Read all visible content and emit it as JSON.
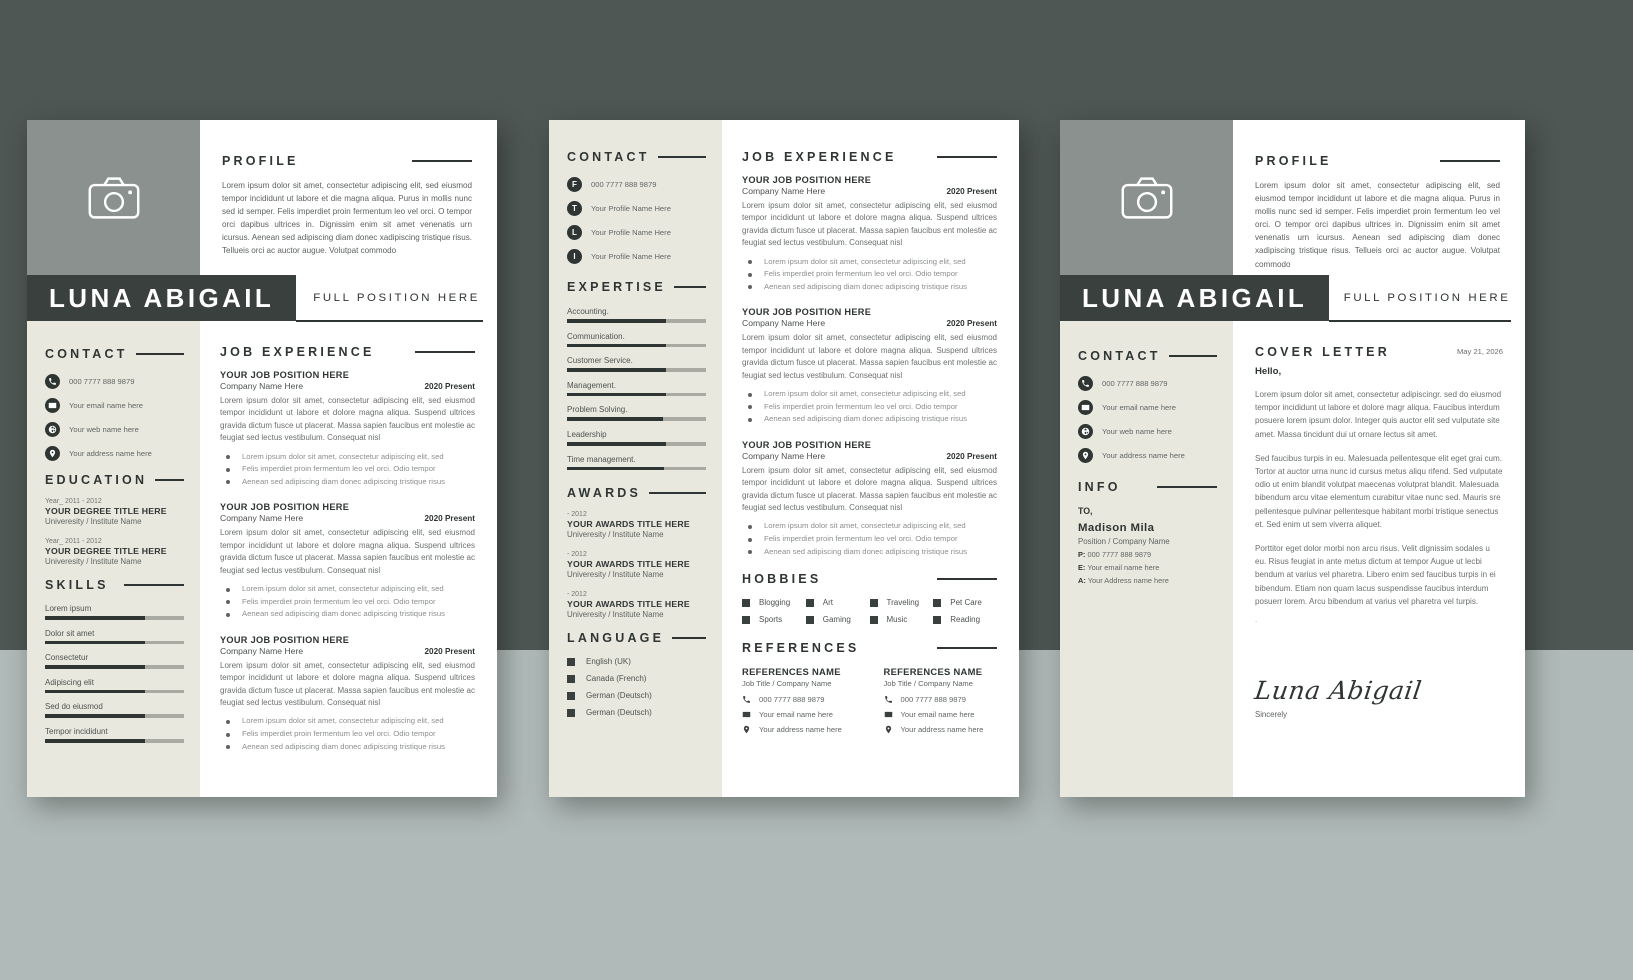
{
  "theme": {
    "bg_top": "#4e5754",
    "bg_bottom": "#b0bab8",
    "dark": "#3a403d",
    "sidebar": "#e9e8df",
    "photo_grey": "#8a918e",
    "bar_track": "#a9aaa2"
  },
  "person": {
    "name": "LUNA ABIGAIL",
    "position": "FULL POSITION HERE"
  },
  "sections": {
    "profile": "PROFILE",
    "contact": "CONTACT",
    "education": "EDUCATION",
    "skills": "SKILLS",
    "job_experience": "JOB EXPERIENCE",
    "expertise": "EXPERTISE",
    "awards": "AWARDS",
    "language": "LANGUAGE",
    "hobbies": "HOBBIES",
    "references": "REFERENCES",
    "cover_letter": "COVER LETTER",
    "info": "INFO"
  },
  "profile_text": "Lorem ipsum dolor sit amet, consectetur adipiscing elit, sed eiusmod tempor incididunt ut labore et die magna aliqua. Purus in mollis nunc sed id semper. Felis imperdiet proin fermentum leo vel orci. O tempor orci dapibus ultrices in. Dignissim enim sit amet venenatis urn icursus. Aenean sed adipiscing diam donec xadipiscing tristique risus. Tellueis orci ac auctor augue. Volutpat commodo",
  "contact_items": [
    {
      "icon": "phone-icon",
      "text": "000 7777 888 9879"
    },
    {
      "icon": "email-icon",
      "text": "Your email name here"
    },
    {
      "icon": "web-icon",
      "text": "Your web name here"
    },
    {
      "icon": "location-icon",
      "text": "Your address name here"
    }
  ],
  "social_items": [
    {
      "icon": "facebook-icon",
      "letter": "F",
      "text": "000 7777 888 9879"
    },
    {
      "icon": "twitter-icon",
      "letter": "T",
      "text": "Your Profile Name Here"
    },
    {
      "icon": "linkedin-icon",
      "letter": "L",
      "text": "Your Profile Name Here"
    },
    {
      "icon": "instagram-icon",
      "letter": "I",
      "text": "Your Profile Name Here"
    }
  ],
  "education": [
    {
      "year": "Year_ 2011 - 2012",
      "title": "YOUR DEGREE TITLE HERE",
      "school": "Univeresity / Institute Name"
    },
    {
      "year": "Year_ 2011 - 2012",
      "title": "YOUR DEGREE TITLE HERE",
      "school": "Univeresity / Institute Name"
    }
  ],
  "skills": [
    {
      "name": "Lorem ipsum",
      "value": 72
    },
    {
      "name": "Dolor sit amet",
      "value": 72
    },
    {
      "name": "Consectetur",
      "value": 72
    },
    {
      "name": "Adipiscing elit",
      "value": 72
    },
    {
      "name": "Sed do eiusmod",
      "value": 72
    },
    {
      "name": "Tempor incididunt",
      "value": 72
    }
  ],
  "expertise": [
    {
      "name": "Accounting.",
      "value": 71
    },
    {
      "name": "Communication.",
      "value": 71
    },
    {
      "name": "Customer Service.",
      "value": 71
    },
    {
      "name": "Management.",
      "value": 71
    },
    {
      "name": "Problem Solving.",
      "value": 69
    },
    {
      "name": "Leadership",
      "value": 71
    },
    {
      "name": "Time management.",
      "value": 70
    }
  ],
  "jobs": [
    {
      "position": "YOUR JOB POSITION HERE",
      "company": "Company Name Here",
      "date": "2020 Present",
      "desc": "Lorem ipsum dolor sit amet, consectetur adipiscing elit, sed eiusmod tempor incididunt ut labore et dolore magna aliqua. Suspend ultrices gravida dictum fusce ut placerat. Massa sapien faucibus ent molestie ac feugiat sed lectus vestibulum. Consequat nisl",
      "bullets": [
        "Lorem ipsum dolor sit amet, consectetur adipiscing elit, sed",
        "Felis imperdiet proin fermentum leo vel orci. Odio tempor",
        "Aenean sed adipiscing diam donec adipiscing tristique risus"
      ]
    },
    {
      "position": "YOUR JOB POSITION HERE",
      "company": "Company Name Here",
      "date": "2020 Present",
      "desc": "Lorem ipsum dolor sit amet, consectetur adipiscing elit, sed eiusmod tempor incididunt ut labore et dolore magna aliqua. Suspend ultrices gravida dictum fusce ut placerat. Massa sapien faucibus ent molestie ac feugiat sed lectus vestibulum. Consequat nisl",
      "bullets": [
        "Lorem ipsum dolor sit amet, consectetur adipiscing elit, sed",
        "Felis imperdiet proin fermentum leo vel orci. Odio tempor",
        "Aenean sed adipiscing diam donec adipiscing tristique risus"
      ]
    },
    {
      "position": "YOUR JOB POSITION HERE",
      "company": "Company Name Here",
      "date": "2020 Present",
      "desc": "Lorem ipsum dolor sit amet, consectetur adipiscing elit, sed eiusmod tempor incididunt ut labore et dolore magna aliqua. Suspend ultrices gravida dictum fusce ut placerat. Massa sapien faucibus ent molestie ac feugiat sed lectus vestibulum. Consequat nisl",
      "bullets": [
        "Lorem ipsum dolor sit amet, consectetur adipiscing elit, sed",
        "Felis imperdiet proin fermentum leo vel orci. Odio tempor",
        "Aenean sed adipiscing diam donec adipiscing tristique risus"
      ]
    }
  ],
  "awards": [
    {
      "year": "- 2012",
      "title": "YOUR AWARDS TITLE HERE",
      "school": "Univeresity / Institute Name"
    },
    {
      "year": "- 2012",
      "title": "YOUR AWARDS TITLE HERE",
      "school": "Univeresity / Institute Name"
    },
    {
      "year": "- 2012",
      "title": "YOUR AWARDS TITLE HERE",
      "school": "Univeresity / Institute Name"
    }
  ],
  "languages": [
    "English (UK)",
    "Canada (French)",
    "German (Deutsch)",
    "German (Deutsch)"
  ],
  "hobbies": [
    "Blogging",
    "Art",
    "Traveling",
    "Pet Care",
    "Sports",
    "Gaming",
    "Music",
    "Reading"
  ],
  "references": [
    {
      "name": "REFERENCES NAME",
      "sub": "Job Title / Company Name",
      "rows": [
        {
          "icon": "phone-icon",
          "text": "000 7777 888 9879"
        },
        {
          "icon": "email-icon",
          "text": "Your email name here"
        },
        {
          "icon": "location-icon",
          "text": "Your address name here"
        }
      ]
    },
    {
      "name": "REFERENCES NAME",
      "sub": "Job Title / Company Name",
      "rows": [
        {
          "icon": "phone-icon",
          "text": "000 7777 888 9879"
        },
        {
          "icon": "email-icon",
          "text": "Your email name here"
        },
        {
          "icon": "location-icon",
          "text": "Your address name here"
        }
      ]
    }
  ],
  "cover_letter": {
    "date": "May 21, 2026",
    "hello": "Hello,",
    "p1": "Lorem ipsum dolor sit amet, consectetur adipiscingr. sed do eiusmod tempor incididunt ut labore et dolore magr aliqua. Faucibus interdum posuere lorem ipsum dolor. Integer quis auctor elit sed vulputate site amet. Massa tincidunt dui ut ornare lectus sit amet.",
    "p2": "Sed faucibus turpis in eu. Malesuada pellentesque elit eget grai cum. Tortor at auctor urna nunc id cursus metus aliqu rifend. Sed vulputate odio ut enim blandit volutpat maecenas volutprat blandit. Malesuada bibendum arcu vitae elementum curabitur vitae nunc sed. Mauris sre pellentesque pulvinar pellentesque habitant morbi tristique senectus et. Sed enim ut sem viverra aliquet.",
    "p3": "Porttitor eget dolor morbi non arcu risus. Velit dignissim sodales u eu. Risus feugiat in ante metus dictum at tempor Augue ut lecbi bendum at varius vel pharetra. Libero enim sed faucibus turpis in ei bibendum. Etiam non quam lacus suspendisse faucibus interdum posuerr lorem. Arcu bibendum at varius vel pharetra vel turpis.",
    "dot": ".",
    "signature": "Luna Abigail",
    "sincerely": "Sincerely"
  },
  "info": {
    "to_label": "TO,",
    "name": "Madison Mila",
    "position": "Position / Company Name",
    "phone_label": "P:",
    "phone": "000 7777 888 9879",
    "email_label": "E:",
    "email": "Your  email name here",
    "address_label": "A:",
    "address": "Your  Address name here"
  }
}
